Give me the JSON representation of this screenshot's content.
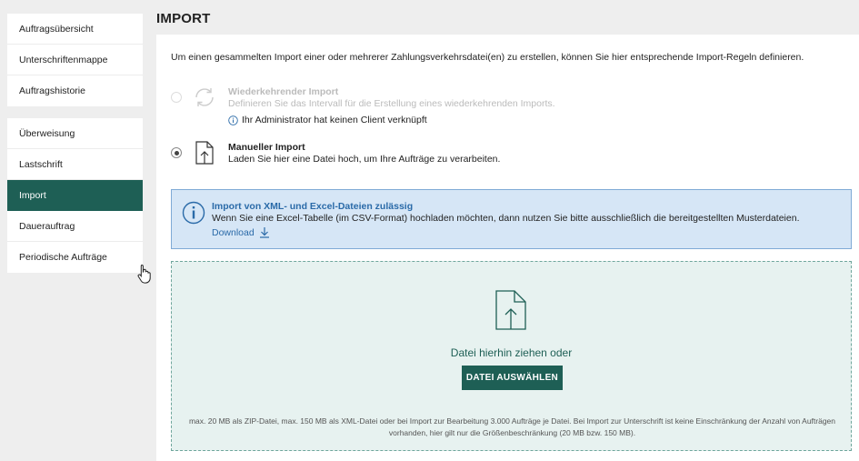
{
  "sidebar": {
    "group1": [
      {
        "label": "Auftragsübersicht"
      },
      {
        "label": "Unterschriftenmappe"
      },
      {
        "label": "Auftragshistorie"
      }
    ],
    "group2": [
      {
        "label": "Überweisung"
      },
      {
        "label": "Lastschrift"
      },
      {
        "label": "Import",
        "active": true
      },
      {
        "label": "Dauerauftrag"
      },
      {
        "label": "Periodische Aufträge"
      }
    ]
  },
  "page": {
    "title": "IMPORT",
    "intro": "Um einen gesammelten Import einer oder mehrerer Zahlungsverkehrsdatei(en) zu erstellen, können Sie hier entsprechende Import-Regeln definieren."
  },
  "options": {
    "recurring": {
      "title": "Wiederkehrender Import",
      "desc": "Definieren Sie das Intervall für die Erstellung eines wiederkehrenden Imports.",
      "note": "Ihr Administrator hat keinen Client verknüpft",
      "selected": false,
      "disabled": true
    },
    "manual": {
      "title": "Manueller Import",
      "desc": "Laden Sie hier eine Datei hoch, um Ihre Aufträge zu verarbeiten.",
      "selected": true
    }
  },
  "info_box": {
    "title": "Import von XML- und Excel-Dateien zulässig",
    "text": "Wenn Sie eine Excel-Tabelle (im CSV-Format) hochladen möchten, dann nutzen Sie bitte ausschließlich die bereitgestellten Musterdateien.",
    "download_label": "Download"
  },
  "dropzone": {
    "text": "Datei hierhin ziehen oder",
    "button_label": "DATEI AUSWÄHLEN",
    "limits": "max. 20 MB als ZIP-Datei, max. 150 MB als XML-Datei oder bei Import zur Bearbeitung 3.000 Aufträge je Datei. Bei Import zur Unterschrift ist keine Einschränkung der Anzahl von Aufträgen vorhanden, hier gilt nur die Größenbeschränkung (20 MB bzw. 150 MB)."
  },
  "colors": {
    "primary": "#1e5f55",
    "info_bg": "#d6e6f6",
    "info_border": "#7faad6",
    "link": "#2a6aa8",
    "drop_bg": "#e7f2f0"
  }
}
